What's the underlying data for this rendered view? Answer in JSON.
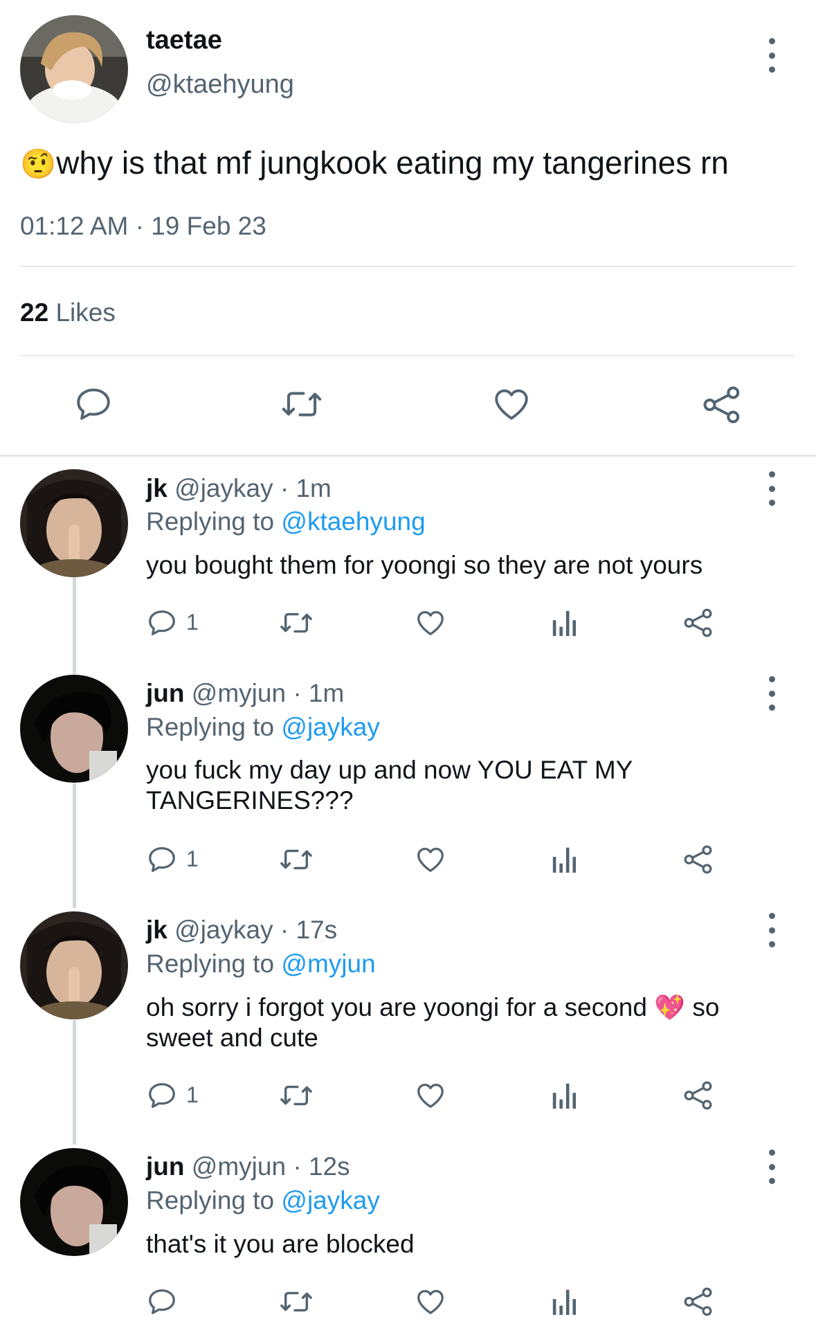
{
  "main_tweet": {
    "display_name": "taetae",
    "handle": "@ktaehyung",
    "emoji": "🤨",
    "text": "why is that mf jungkook eating my tangerines rn",
    "timestamp": "01:12 AM · 19 Feb 23",
    "likes_count": "22",
    "likes_label": "Likes"
  },
  "replies": [
    {
      "display_name": "jk",
      "handle": "@jaykay",
      "age": "· 1m",
      "replying_label": "Replying to",
      "replying_to": "@ktaehyung",
      "text": "you bought them for yoongi so they are not yours",
      "reply_count": "1"
    },
    {
      "display_name": "jun",
      "handle": "@myjun",
      "age": "· 1m",
      "replying_label": "Replying to",
      "replying_to": "@jaykay",
      "text": "you fuck my day up and now YOU EAT MY TANGERINES???",
      "reply_count": "1"
    },
    {
      "display_name": "jk",
      "handle": "@jaykay",
      "age": "· 17s",
      "replying_label": "Replying to",
      "replying_to": "@myjun",
      "text_before_emoji": "oh sorry i forgot you are yoongi for a second ",
      "emoji": "💖",
      "text_after_emoji": " so sweet and cute",
      "reply_count": "1"
    },
    {
      "display_name": "jun",
      "handle": "@myjun",
      "age": "· 12s",
      "replying_label": "Replying to",
      "replying_to": "@jaykay",
      "text": "that's it you are blocked",
      "reply_count": ""
    }
  ],
  "icons": {
    "reply": "reply-bubble-icon",
    "retweet": "retweet-icon",
    "like": "heart-icon",
    "views": "analytics-bars-icon",
    "share": "share-icon",
    "more": "more-vertical-icon"
  },
  "colors": {
    "icon_gray": "#536471",
    "link_blue": "#1d9bf0",
    "divider": "#e8ebed",
    "thread_line": "#cfd9de"
  }
}
